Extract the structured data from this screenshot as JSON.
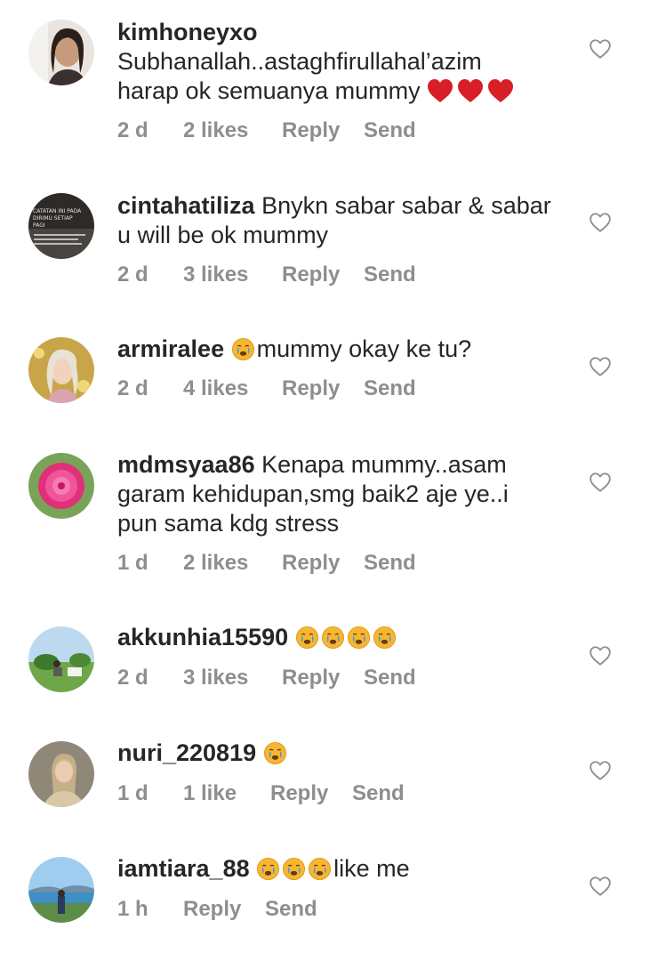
{
  "comments": [
    {
      "username": "kimhoneyxo",
      "text_line1": "Subhanallah..astaghfirullahal’azim",
      "text_line2": "harap ok semuanya mummy",
      "age": "2 d",
      "likes": "2 likes",
      "reply": "Reply",
      "send": "Send"
    },
    {
      "username": "cintahatiliza",
      "text": "Bnykn sabar sabar & sabar",
      "text_line2": "u will be ok mummy",
      "age": "2 d",
      "likes": "3 likes",
      "reply": "Reply",
      "send": "Send",
      "avatar_text": [
        "CATATAN INI PADA",
        "DIRIMU SETIAP",
        "PAGI"
      ]
    },
    {
      "username": "armiralee",
      "text": "mummy okay ke tu?",
      "age": "2 d",
      "likes": "4 likes",
      "reply": "Reply",
      "send": "Send"
    },
    {
      "username": "mdmsyaa86",
      "text": "Kenapa mummy..asam",
      "text_line2": "garam kehidupan,smg baik2 aje ye..i",
      "text_line3": "pun sama kdg stress",
      "age": "1 d",
      "likes": "2 likes",
      "reply": "Reply",
      "send": "Send"
    },
    {
      "username": "akkunhia15590",
      "age": "2 d",
      "likes": "3 likes",
      "reply": "Reply",
      "send": "Send"
    },
    {
      "username": "nuri_220819",
      "age": "1 d",
      "likes": "1 like",
      "reply": "Reply",
      "send": "Send"
    },
    {
      "username": "iamtiara_88",
      "text": "like me",
      "age": "1 h",
      "reply": "Reply",
      "send": "Send"
    }
  ],
  "colors": {
    "meta": "#8e8e8e",
    "text": "#262626",
    "heart_red": "#e0242b"
  },
  "icons": {
    "like": "heart-outline-icon",
    "crying_emoji": "crying-face-emoji",
    "red_heart": "red-heart-emoji"
  }
}
